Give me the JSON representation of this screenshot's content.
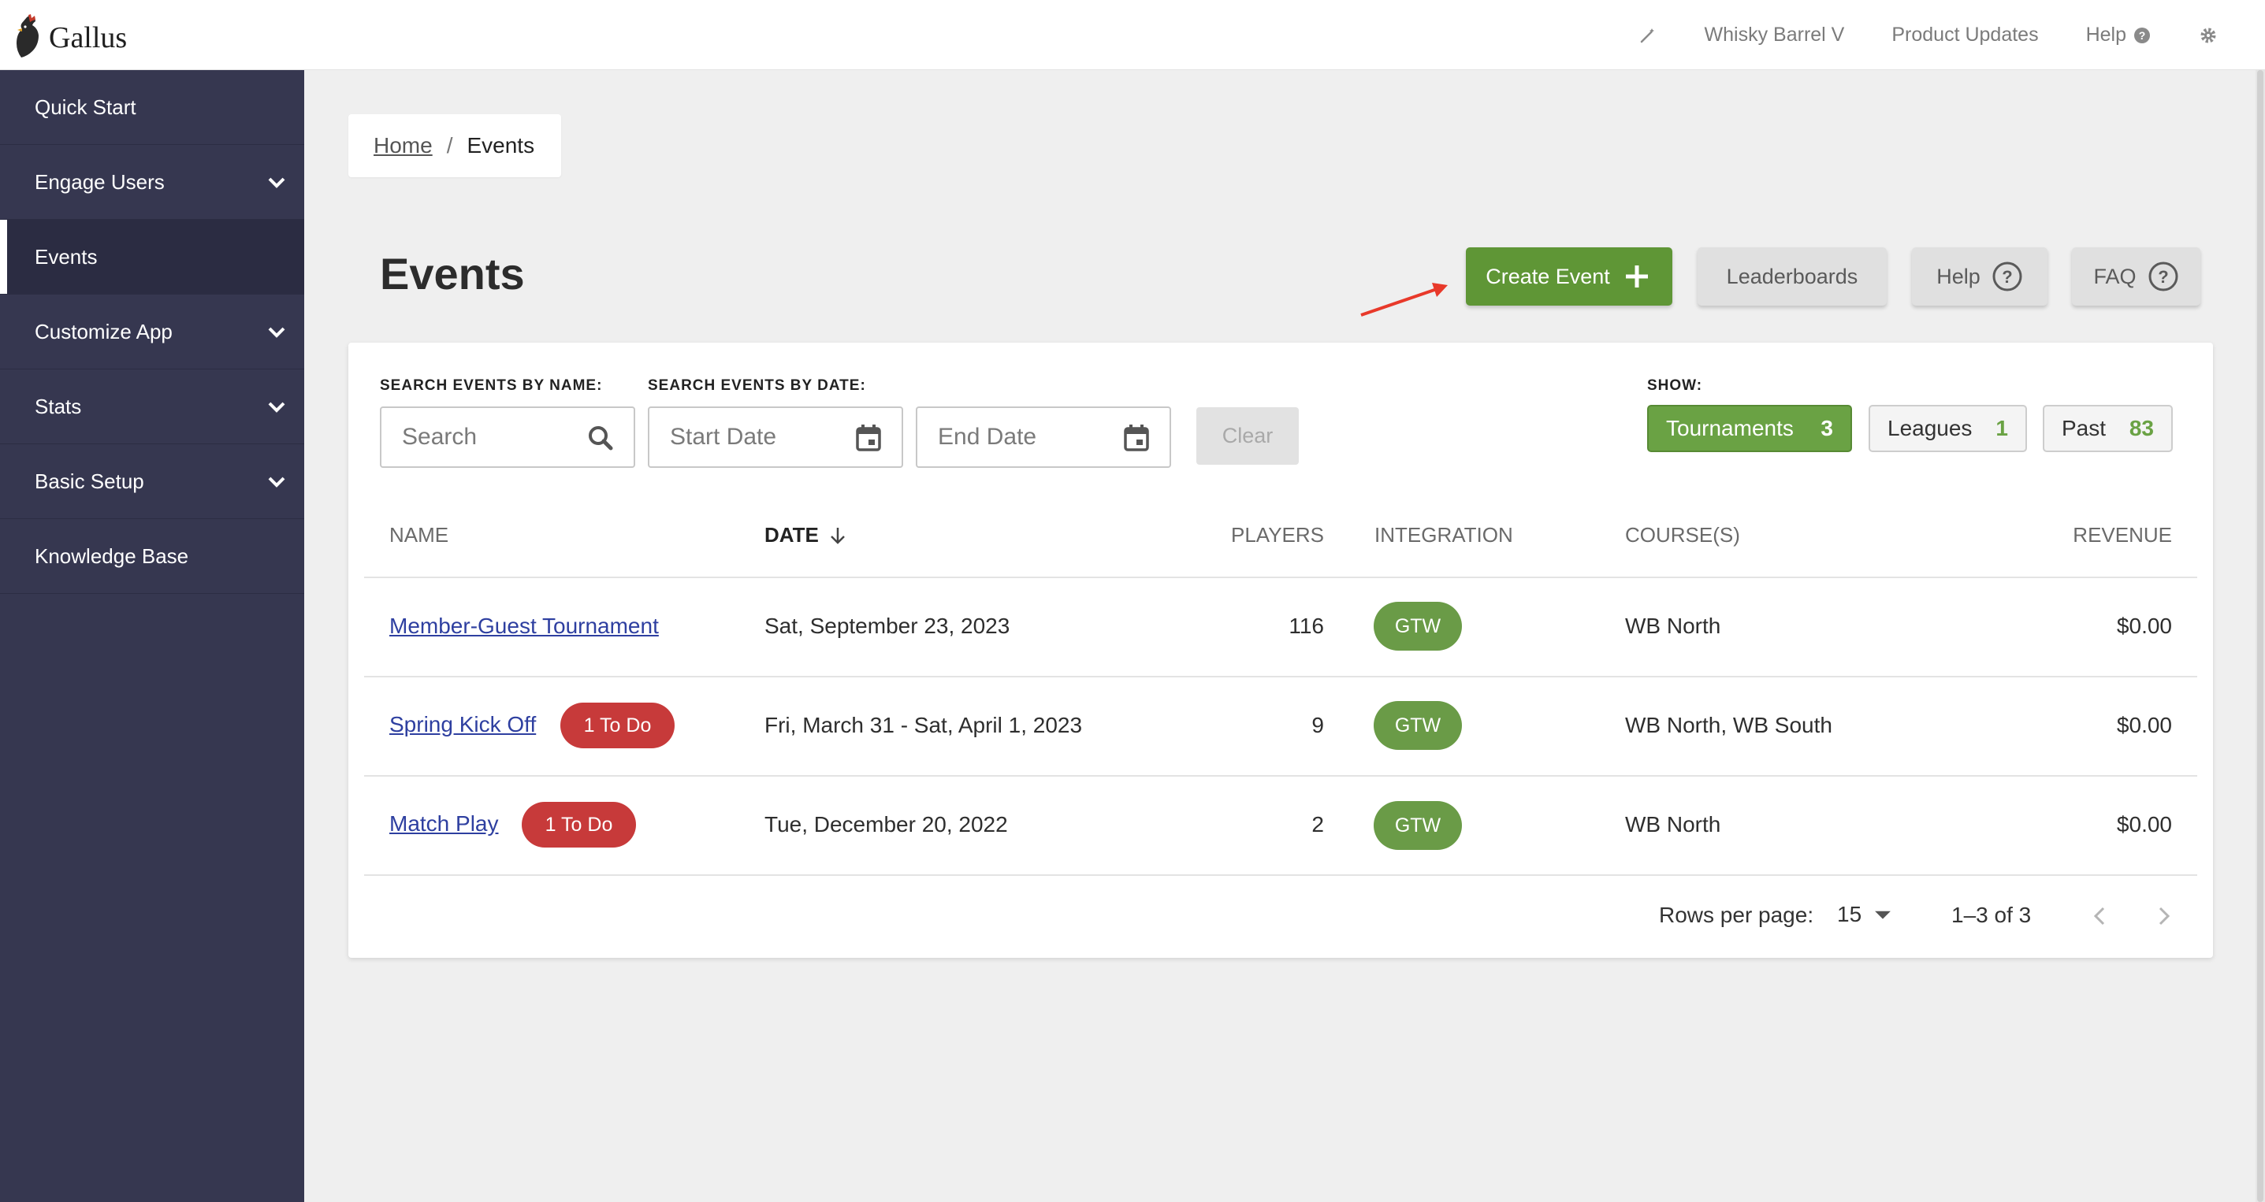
{
  "app": {
    "name": "Gallus"
  },
  "topnav": {
    "club": "Whisky Barrel V",
    "updates": "Product Updates",
    "help": "Help"
  },
  "sidebar": {
    "items": [
      {
        "label": "Quick Start"
      },
      {
        "label": "Engage Users"
      },
      {
        "label": "Events"
      },
      {
        "label": "Customize App"
      },
      {
        "label": "Stats"
      },
      {
        "label": "Basic Setup"
      },
      {
        "label": "Knowledge Base"
      }
    ]
  },
  "breadcrumb": {
    "home": "Home",
    "separator": "/",
    "current": "Events"
  },
  "page": {
    "title": "Events"
  },
  "actions": {
    "create": "Create Event",
    "leaderboards": "Leaderboards",
    "help": "Help",
    "faq": "FAQ"
  },
  "filters": {
    "name_label": "SEARCH EVENTS BY NAME:",
    "date_label": "SEARCH EVENTS BY DATE:",
    "search_placeholder": "Search",
    "start_placeholder": "Start Date",
    "end_placeholder": "End Date",
    "clear": "Clear",
    "show_label": "SHOW:",
    "chips": [
      {
        "label": "Tournaments",
        "count": "3"
      },
      {
        "label": "Leagues",
        "count": "1"
      },
      {
        "label": "Past",
        "count": "83"
      }
    ]
  },
  "table": {
    "headers": {
      "name": "NAME",
      "date": "DATE",
      "players": "PLAYERS",
      "integration": "INTEGRATION",
      "courses": "COURSE(S)",
      "revenue": "REVENUE"
    },
    "rows": [
      {
        "name": "Member-Guest Tournament",
        "todo": "",
        "date": "Sat, September 23, 2023",
        "players": "116",
        "integration": "GTW",
        "courses": "WB North",
        "revenue": "$0.00"
      },
      {
        "name": "Spring Kick Off",
        "todo": "1 To Do",
        "date": "Fri, March 31 - Sat, April 1, 2023",
        "players": "9",
        "integration": "GTW",
        "courses": "WB North, WB South",
        "revenue": "$0.00"
      },
      {
        "name": "Match Play",
        "todo": "1 To Do",
        "date": "Tue, December 20, 2022",
        "players": "2",
        "integration": "GTW",
        "courses": "WB North",
        "revenue": "$0.00"
      }
    ]
  },
  "pagination": {
    "rows_label": "Rows per page:",
    "rows_value": "15",
    "range": "1–3 of 3"
  },
  "colors": {
    "sidebar": "#363750",
    "primary_green": "#5f9636",
    "todo_red": "#c73a3a",
    "link": "#2e3fa0"
  }
}
